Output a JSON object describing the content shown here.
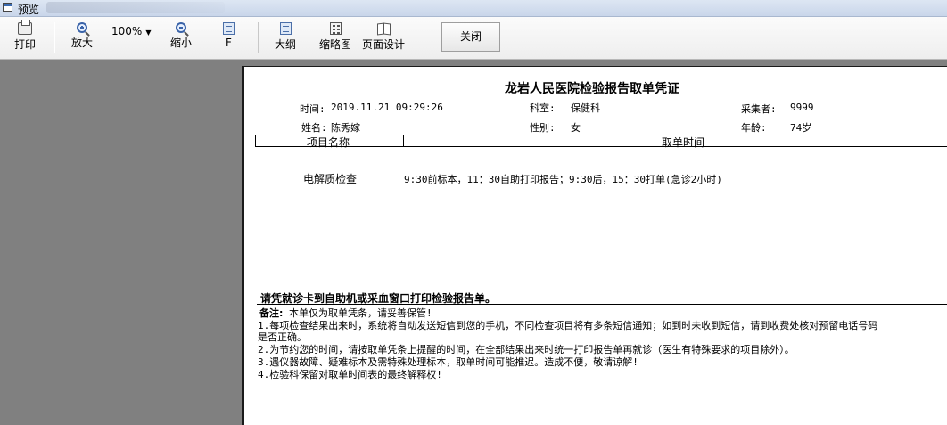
{
  "window": {
    "title": "预览"
  },
  "toolbar": {
    "print": "打印",
    "zoom_in": "放大",
    "zoom_value": "100%",
    "zoom_out": "缩小",
    "fit": "F",
    "outline": "大纲",
    "thumbnail": "缩略图",
    "page_setup": "页面设计",
    "close": "关闭"
  },
  "report": {
    "title": "龙岩人民医院检验报告取单凭证",
    "time_label": "时间:",
    "time_value": "2019.11.21 09:29:26",
    "dept_label": "科室:",
    "dept_value": "保健科",
    "collector_label": "采集者:",
    "collector_value": "9999",
    "name_label": "姓名:",
    "name_value": "陈秀嫁",
    "gender_label": "性别:",
    "gender_value": "女",
    "age_label": "年龄:",
    "age_value": "74岁",
    "col_item": "项目名称",
    "col_time": "取单时间",
    "rows": [
      {
        "item": "电解质检查",
        "time": "9:30前标本，11：30自助打印报告；9:30后，15：30打单(急诊2小时)"
      }
    ],
    "instruction": "请凭就诊卡到自助机或采血窗口打印检验报告单。",
    "note_label": "备注:",
    "note_text": "本单仅为取单凭条，请妥善保管!",
    "notes": [
      "1.每项检查结果出来时，系统将自动发送短信到您的手机，不同检查项目将有多条短信通知；如到时未收到短信，请到收费处核对预留电话号码",
      "是否正确。",
      "2.为节约您的时间，请按取单凭条上提醒的时间，在全部结果出来时统一打印报告单再就诊（医生有特殊要求的项目除外）。",
      "3.遇仪器故障、疑难标本及需特殊处理标本，取单时间可能推迟。造成不便，敬请谅解!",
      "4.检验科保留对取单时间表的最终解释权!"
    ]
  }
}
